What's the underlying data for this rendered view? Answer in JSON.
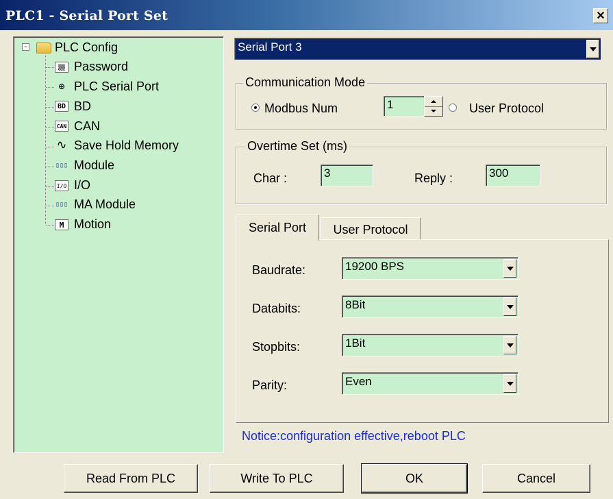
{
  "window": {
    "title": "PLC1 - Serial Port  Set",
    "close_glyph": "×"
  },
  "tree": {
    "root": {
      "label": "PLC Config",
      "expander": "−",
      "icon": "folder-icon"
    },
    "items": [
      {
        "label": "Password",
        "icon": "password-icon",
        "glyph": "▒▒"
      },
      {
        "label": "PLC Serial Port",
        "icon": "serial-port-icon",
        "glyph": "⊕"
      },
      {
        "label": "BD",
        "icon": "bd-icon",
        "glyph": "BD"
      },
      {
        "label": "CAN",
        "icon": "can-icon",
        "glyph": "CAN"
      },
      {
        "label": "Save Hold Memory",
        "icon": "memory-waveform-icon",
        "glyph": "∿"
      },
      {
        "label": "Module",
        "icon": "module-icon",
        "glyph": "▯▯▯"
      },
      {
        "label": "I/O",
        "icon": "io-icon",
        "glyph": "I/O"
      },
      {
        "label": "MA Module",
        "icon": "ma-module-icon",
        "glyph": "▯▯▯"
      },
      {
        "label": "Motion",
        "icon": "motion-icon",
        "glyph": "M"
      }
    ]
  },
  "port_select": {
    "value": "Serial Port 3"
  },
  "comm_mode": {
    "title": "Communication Mode",
    "modbus_label": "Modbus Num",
    "modbus_num": "1",
    "user_protocol_label": "User Protocol",
    "selected": "modbus"
  },
  "overtime": {
    "title": "Overtime Set (ms)",
    "char_label": "Char :",
    "char_value": "3",
    "reply_label": "Reply :",
    "reply_value": "300"
  },
  "tabs": [
    {
      "label": "Serial Port",
      "active": true
    },
    {
      "label": "User Protocol",
      "active": false
    }
  ],
  "serial": {
    "baudrate_label": "Baudrate:",
    "baudrate": "19200 BPS",
    "databits_label": "Databits:",
    "databits": "8Bit",
    "stopbits_label": "Stopbits:",
    "stopbits": "1Bit",
    "parity_label": "Parity:",
    "parity": "Even"
  },
  "notice": "Notice:configuration effective,reboot PLC",
  "buttons": {
    "read": "Read From PLC",
    "write": "Write To PLC",
    "ok": "OK",
    "cancel": "Cancel"
  },
  "colors": {
    "field_bg": "#c8f0cc",
    "dialog_bg": "#ece9d8",
    "notice": "#1a2ccc",
    "title_start": "#0a246a",
    "title_end": "#a6caf0"
  }
}
